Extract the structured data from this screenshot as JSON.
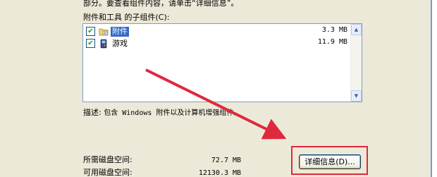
{
  "dialog": {
    "instruction_text": "部分。要查看组件内容，请单击“详细信息”。",
    "list_caption": "附件和工具 的子组件(C):",
    "components": [
      {
        "name": "附件",
        "size": "3.3 MB",
        "checked": true,
        "selected": true,
        "icon": "accessories-folder-icon"
      },
      {
        "name": "游戏",
        "size": "11.9 MB",
        "checked": true,
        "selected": false,
        "icon": "games-icon"
      }
    ],
    "description_label": "描述:",
    "description_value": "包含 Windows 附件以及计算机增强组件。",
    "required_space_label": "所需磁盘空间:",
    "required_space_value": "72.7",
    "required_space_unit": "MB",
    "available_space_label": "可用磁盘空间:",
    "available_space_value": "12130.3",
    "available_space_unit": "MB",
    "details_button_label": "详细信息(D)...",
    "checkmark": "✔",
    "scroll_up_glyph": "▲",
    "scroll_down_glyph": "▼"
  },
  "annotation": {
    "arrow_color": "#e0283e",
    "highlight_color": "#e0283e"
  }
}
